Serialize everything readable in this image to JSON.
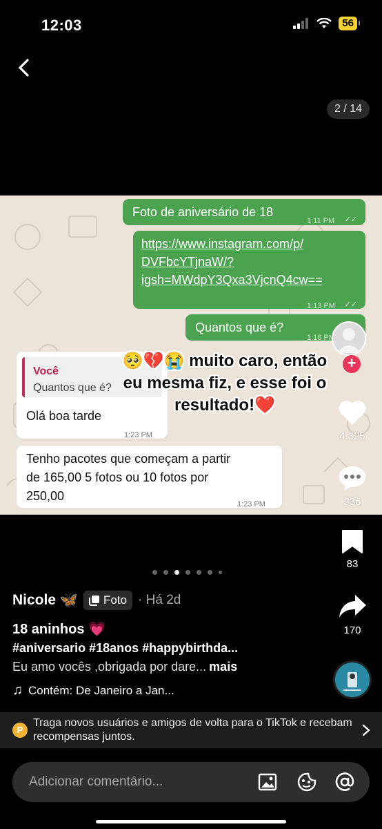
{
  "status": {
    "time": "12:03",
    "battery": "56"
  },
  "viewer": {
    "counter": "2 / 14"
  },
  "chat": {
    "msg1": {
      "text": "Foto de aniversário de 18",
      "time": "1:11 PM"
    },
    "msg2": {
      "line1": "https://www.instagram.com/p/",
      "line2": "DVFbcYTjnaW/?",
      "line3": "igsh=MWdpY3Qxa3VjcnQ4cw==",
      "time": "1:13 PM"
    },
    "msg3": {
      "text": "Quantos que é?",
      "time": "1:16 PM"
    },
    "reply": {
      "quote_name": "Você",
      "quote_text": "Quantos que é?",
      "text": "Olá boa tarde",
      "time": "1:23 PM"
    },
    "msg5": {
      "line1": "Tenho pacotes que começam a partir",
      "line2": "de 165,00 5 fotos ou 10 fotos por",
      "line3": "250,00",
      "time": "1:23 PM"
    }
  },
  "caption": {
    "line1": "🥺💔😭 muito caro, então",
    "line2": "eu mesma fiz, e esse foi o",
    "line3": "resultado!❤️"
  },
  "actions": {
    "likes": "4.325",
    "comments": "336",
    "saves": "83",
    "shares": "170",
    "follow": "+"
  },
  "post": {
    "author": "Nicole 🦋",
    "tag": "Foto",
    "time": "· Há 2d",
    "title": "18 aninhos 💗",
    "hashtags": "#aniversario #18anos #happybirthda...",
    "description": "Eu amo vocês ,obrigada por dare...",
    "more": "mais",
    "music": "Contém: De Janeiro a Jan..."
  },
  "banner": {
    "icon": "P",
    "text": "Traga novos usuários e amigos de volta para o TikTok e recebam recompensas juntos."
  },
  "comment": {
    "placeholder": "Adicionar comentário..."
  },
  "colors": {
    "bubble_out": "#4ba24f",
    "chat_bg": "#ece4d8",
    "follow": "#e8345a",
    "quote_accent": "#c22c5a"
  },
  "carousel": {
    "total_dots": 7,
    "active_dot": 2
  }
}
